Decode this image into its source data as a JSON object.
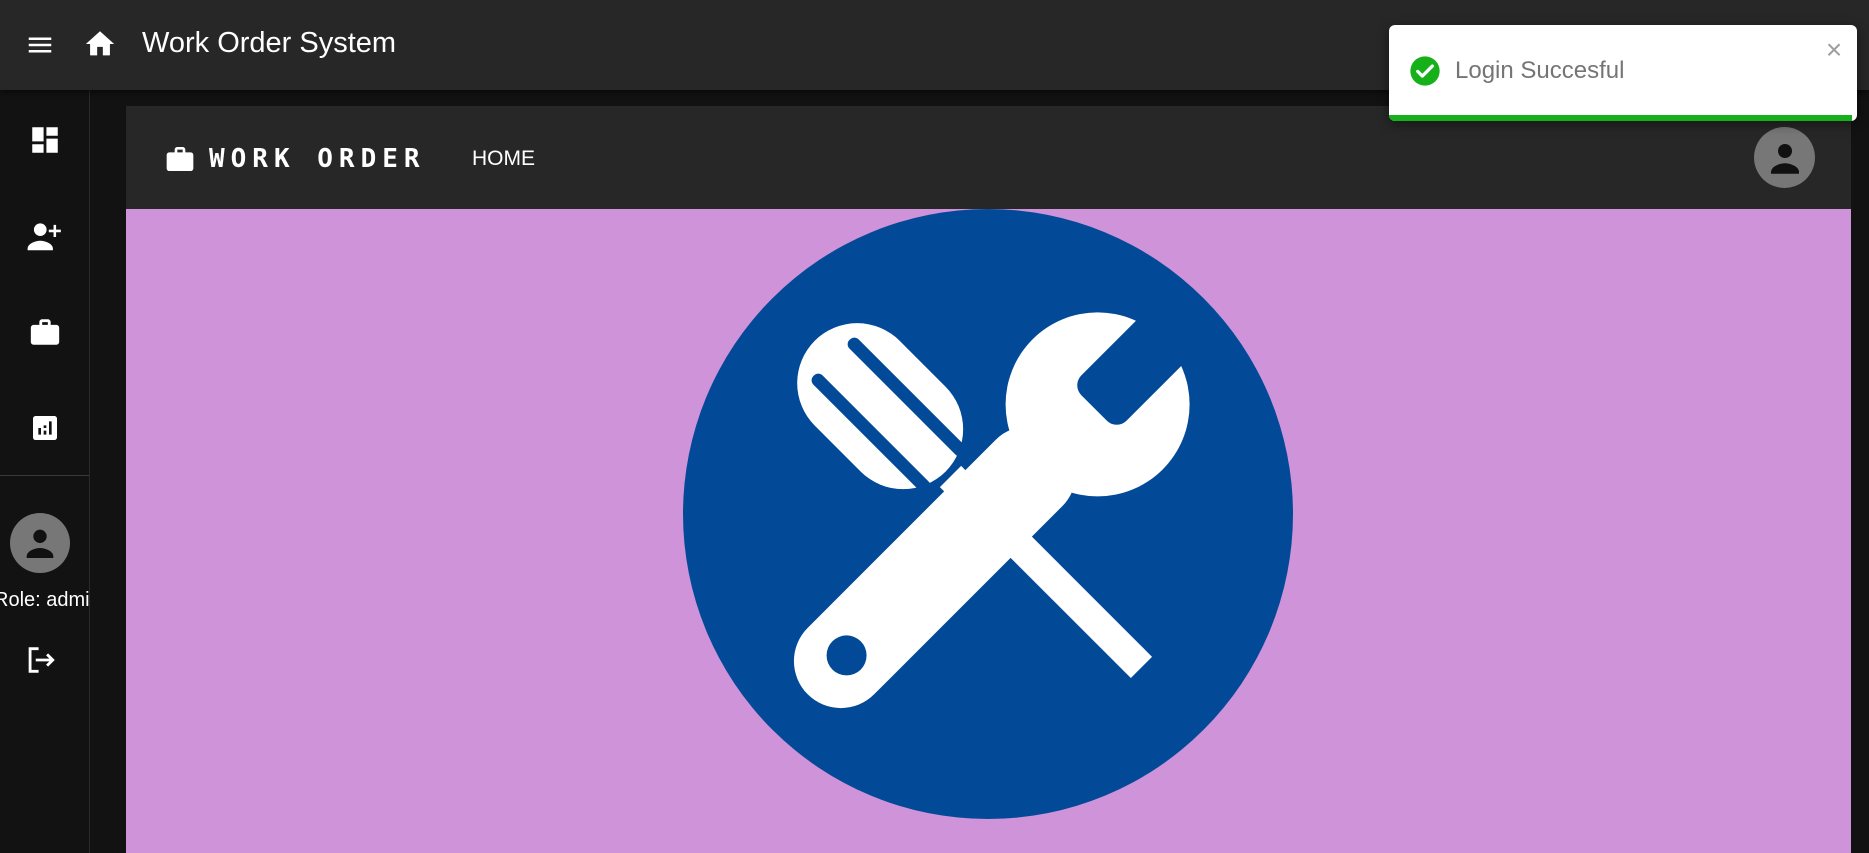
{
  "appbar": {
    "title": "Work Order System",
    "icons": {
      "menu": "menu-icon",
      "home": "home-icon"
    }
  },
  "sidebar": {
    "items": [
      {
        "name": "dashboard",
        "icon": "dashboard-icon"
      },
      {
        "name": "add-user",
        "icon": "person-add-icon"
      },
      {
        "name": "work-orders",
        "icon": "briefcase-icon"
      },
      {
        "name": "reports",
        "icon": "analytics-icon"
      }
    ],
    "role_text": "Role: admin",
    "logout_icon": "logout-icon"
  },
  "toolbar": {
    "brand": "WORK ORDER",
    "brand_icon": "briefcase-icon",
    "home_link": "HOME",
    "profile_icon": "account-icon"
  },
  "hero": {
    "logo_icon": "wrench-screwdriver-icon",
    "background_color": "#ce93d8",
    "circle_color": "#024a97"
  },
  "toast": {
    "message": "Login Succesful",
    "status": "success",
    "color": "#15b01a",
    "progress": 0.99
  }
}
